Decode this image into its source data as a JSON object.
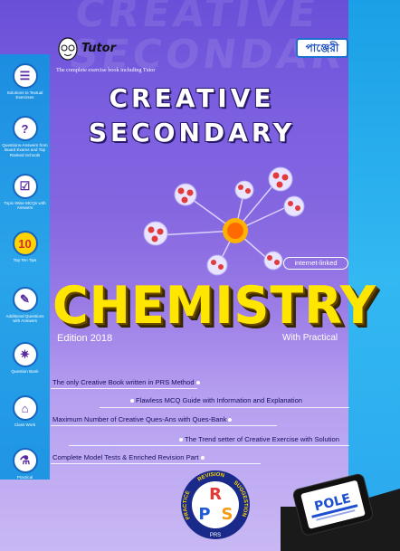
{
  "brand": {
    "logo": "Tutor",
    "tagline": "The complete exercise book including Tutor",
    "publisher": "পাঞ্জেরী",
    "publisher_color": "#1d4fc0"
  },
  "titles": {
    "line1": "CREATIVE",
    "line2": "SECONDARY",
    "subject": "CHEMISTRY",
    "edition": "Edition 2018",
    "practical": "With Practical",
    "internet": "internet-linked",
    "subject_color": "#ffe600"
  },
  "sidebar": {
    "items": [
      {
        "label": "Solutions to Textual Exercises",
        "icon": "book-icon",
        "glyph": "☰"
      },
      {
        "label": "Questions-Answers from Board Exams and Top Ranked Schools",
        "icon": "question-icon",
        "glyph": "?"
      },
      {
        "label": "Topic-Wise MCQs with Answers",
        "icon": "mcq-icon",
        "glyph": "☑"
      },
      {
        "label": "Top Ten Tips",
        "icon": "top-ten-icon",
        "glyph": "10"
      },
      {
        "label": "Additional Questions with Answers",
        "icon": "pencil-icon",
        "glyph": "✎"
      },
      {
        "label": "Question Bank",
        "icon": "bulb-icon",
        "glyph": "✷"
      },
      {
        "label": "Class Work",
        "icon": "classwork-icon",
        "glyph": "⌂"
      },
      {
        "label": "Practical",
        "icon": "flask-icon",
        "glyph": "⚗"
      }
    ]
  },
  "features": [
    "The only Creative Book written in PRS Method",
    "Flawless MCQ Guide with Information and Explanation",
    "Maximum Number of Creative Ques-Ans with Ques-Bank",
    "The Trend setter of Creative Exercise with Solution",
    "Complete Model Tests & Enriched Revision Part"
  ],
  "prs": {
    "letters": [
      "P",
      "R",
      "S"
    ],
    "ring_left": "PRACTICE",
    "ring_top": "REVISION",
    "ring_right": "SUGGESTION",
    "bottom": "PRS"
  },
  "pole": {
    "label": "POLE"
  }
}
